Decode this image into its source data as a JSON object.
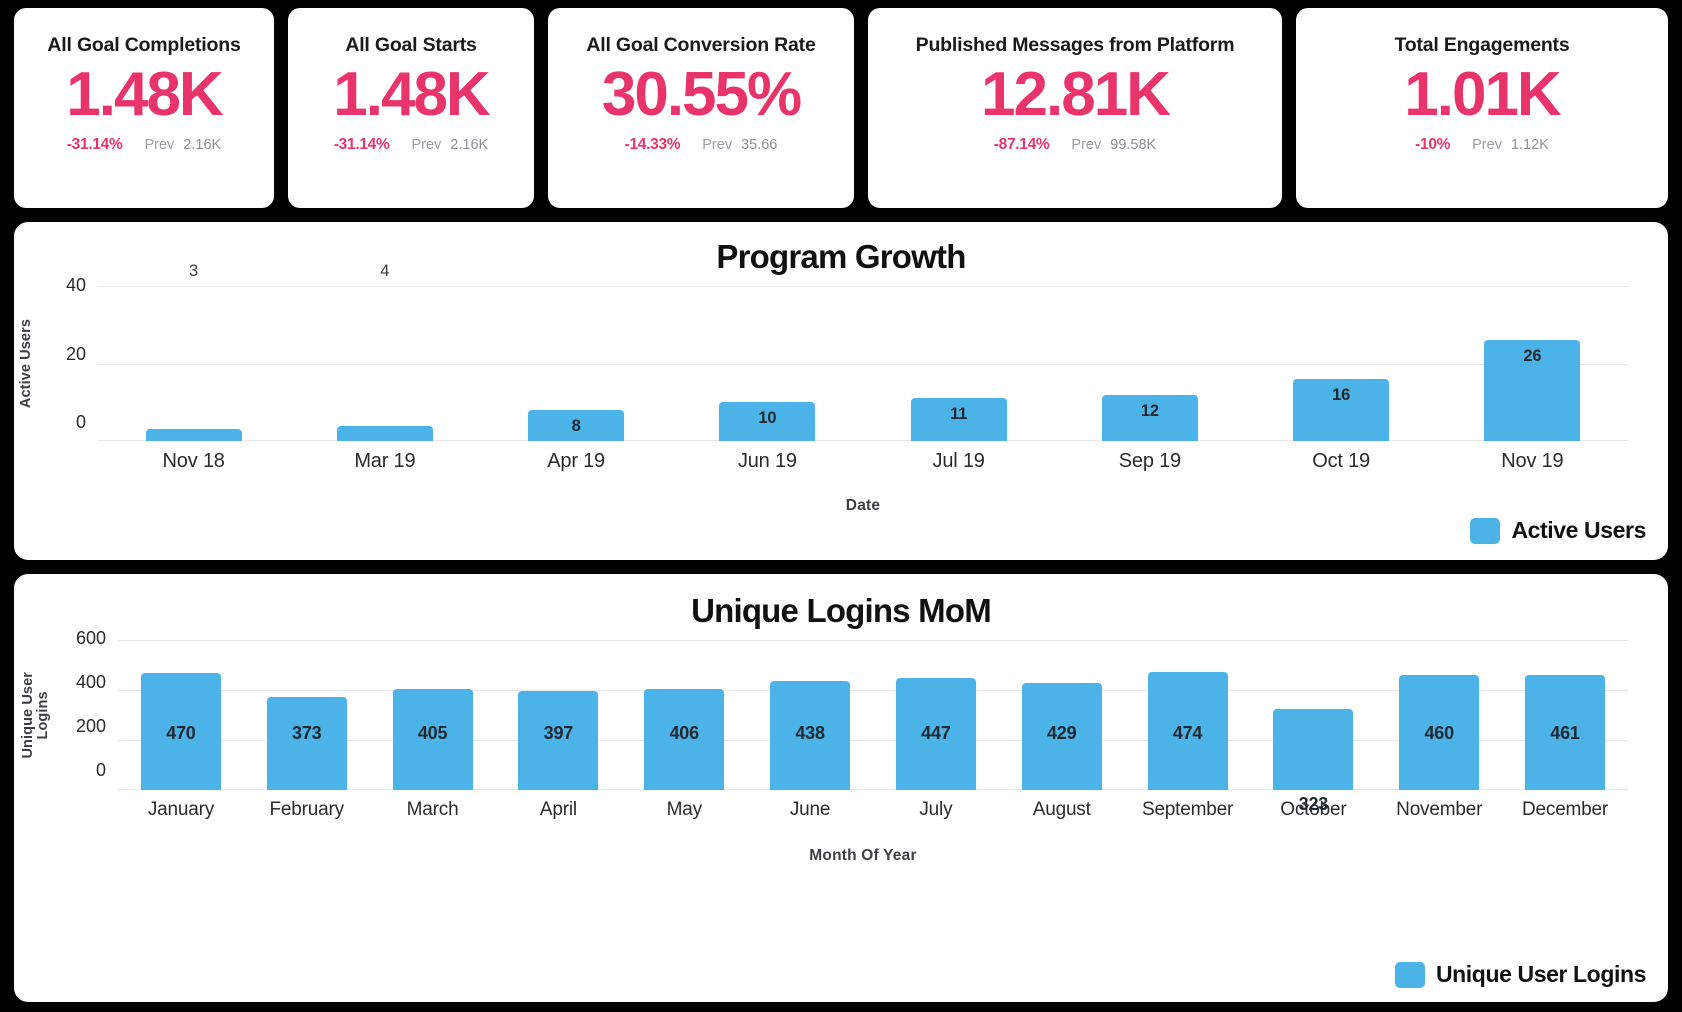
{
  "kpis": [
    {
      "title": "All Goal Completions",
      "value": "1.48K",
      "delta": "-31.14%",
      "prev_label": "Prev",
      "prev_value": "2.16K"
    },
    {
      "title": "All Goal Starts",
      "value": "1.48K",
      "delta": "-31.14%",
      "prev_label": "Prev",
      "prev_value": "2.16K"
    },
    {
      "title": "All Goal Conversion Rate",
      "value": "30.55%",
      "delta": "-14.33%",
      "prev_label": "Prev",
      "prev_value": "35.66"
    },
    {
      "title": "Published Messages from Platform",
      "value": "12.81K",
      "delta": "-87.14%",
      "prev_label": "Prev",
      "prev_value": "99.58K"
    },
    {
      "title": "Total Engagements",
      "value": "1.01K",
      "delta": "-10%",
      "prev_label": "Prev",
      "prev_value": "1.12K"
    }
  ],
  "colors": {
    "accent_pink": "#e8336b",
    "bar_blue": "#4bb3e8",
    "background": "#000000",
    "panel": "#ffffff"
  },
  "chart_data": [
    {
      "type": "bar",
      "title": "Program Growth",
      "xlabel": "Date",
      "ylabel": "Active Users",
      "categories": [
        "Nov 18",
        "Mar 19",
        "Apr 19",
        "Jun 19",
        "Jul 19",
        "Sep 19",
        "Oct 19",
        "Nov 19"
      ],
      "values": [
        3,
        4,
        8,
        10,
        11,
        12,
        16,
        26
      ],
      "ylim": [
        0,
        40
      ],
      "yticks": [
        40,
        20,
        0
      ],
      "grid": true,
      "legend": [
        "Active Users"
      ],
      "legend_position": "bottom-right"
    },
    {
      "type": "bar",
      "title": "Unique Logins MoM",
      "xlabel": "Month Of Year",
      "ylabel": "Unique User\nLogins",
      "categories": [
        "January",
        "February",
        "March",
        "April",
        "May",
        "June",
        "July",
        "August",
        "September",
        "October",
        "November",
        "December"
      ],
      "values": [
        470,
        373,
        405,
        397,
        406,
        438,
        447,
        429,
        474,
        323,
        460,
        461
      ],
      "ylim": [
        0,
        600
      ],
      "yticks": [
        600,
        400,
        200,
        0
      ],
      "grid": true,
      "legend": [
        "Unique User Logins"
      ],
      "legend_position": "bottom-right"
    }
  ]
}
